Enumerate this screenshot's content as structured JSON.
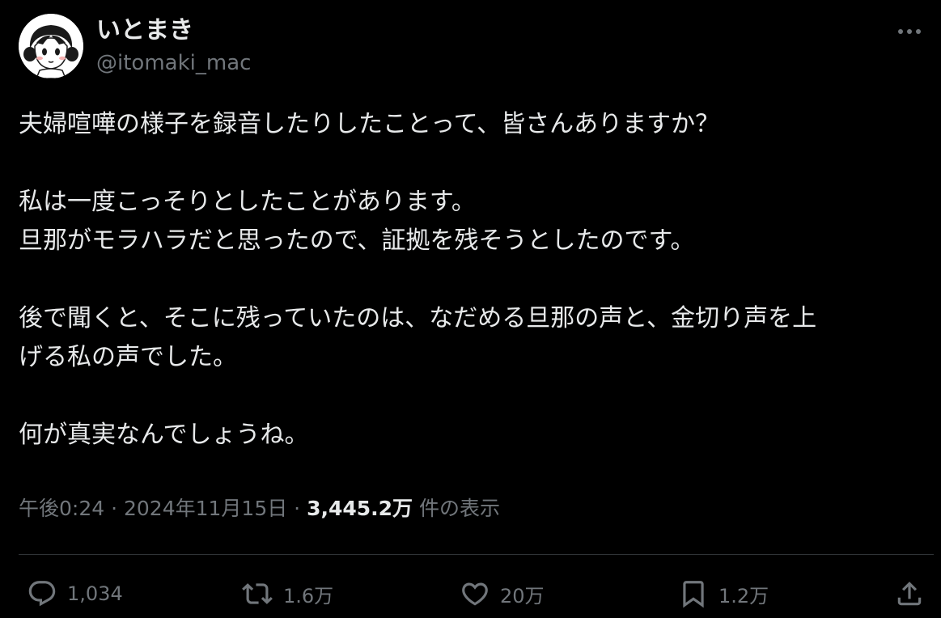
{
  "author": {
    "display_name": "いとまき",
    "handle": "@itomaki_mac"
  },
  "tweet": {
    "paragraphs": [
      [
        "夫婦喧嘩の様子を録音したりしたことって、皆さんありますか？"
      ],
      [
        "私は一度こっそりとしたことがあります。",
        "旦那がモラハラだと思ったので、証拠を残そうとしたのです。"
      ],
      [
        "後で聞くと、そこに残っていたのは、なだめる旦那の声と、金切り声を上",
        "げる私の声でした。"
      ],
      [
        "何が真実なんでしょうね。"
      ]
    ]
  },
  "meta": {
    "time": "午後0:24",
    "separator": " · ",
    "date": "2024年11月15日",
    "views_count": "3,445.2万",
    "views_label": " 件の表示"
  },
  "actions": {
    "reply_count": "1,034",
    "retweet_count": "1.6万",
    "like_count": "20万",
    "bookmark_count": "1.2万"
  },
  "colors": {
    "background": "#000000",
    "text_primary": "#e7e9ea",
    "text_secondary": "#71767b",
    "divider": "#2f3336"
  },
  "icons": {
    "more": "more-horizontal-icon",
    "reply": "reply-icon",
    "retweet": "retweet-icon",
    "like": "heart-icon",
    "bookmark": "bookmark-icon",
    "share": "share-icon"
  }
}
